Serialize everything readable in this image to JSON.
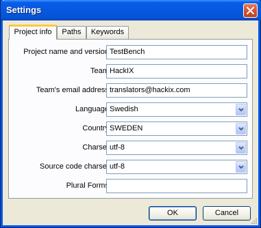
{
  "window": {
    "title": "Settings"
  },
  "tabs": [
    {
      "label": "Project info",
      "active": true
    },
    {
      "label": "Paths",
      "active": false
    },
    {
      "label": "Keywords",
      "active": false
    }
  ],
  "fields": {
    "project_name": {
      "label": "Project name and version:",
      "value": "TestBench"
    },
    "team": {
      "label": "Team:",
      "value": "HackIX"
    },
    "team_email": {
      "label": "Team's email address:",
      "value": "translators@hackix.com"
    },
    "language": {
      "label": "Language:",
      "value": "Swedish"
    },
    "country": {
      "label": "Country:",
      "value": "SWEDEN"
    },
    "charset": {
      "label": "Charset:",
      "value": "utf-8"
    },
    "source_charset": {
      "label": "Source code charset:",
      "value": "utf-8"
    },
    "plural_forms": {
      "label": "Plural Forms:",
      "value": ""
    }
  },
  "buttons": {
    "ok": "OK",
    "cancel": "Cancel"
  },
  "colors": {
    "titlebar": "#0758e0",
    "dialog_bg": "#ece9d8",
    "active_tab_accent": "#ffc83c"
  }
}
